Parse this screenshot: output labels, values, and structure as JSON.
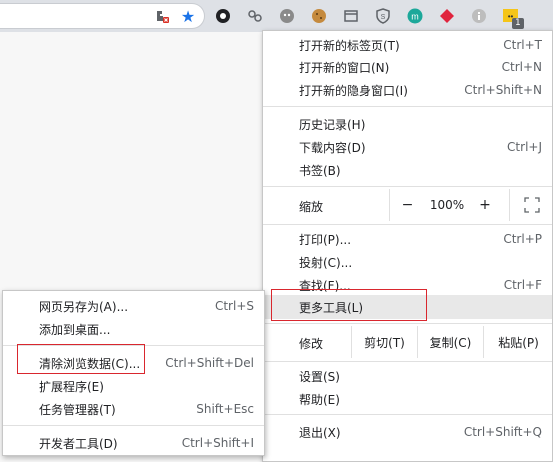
{
  "toolbar": {
    "extension_badge": "1"
  },
  "main_menu": {
    "new_tab": {
      "label": "打开新的标签页(T)",
      "shortcut": "Ctrl+T"
    },
    "new_window": {
      "label": "打开新的窗口(N)",
      "shortcut": "Ctrl+N"
    },
    "new_incognito": {
      "label": "打开新的隐身窗口(I)",
      "shortcut": "Ctrl+Shift+N"
    },
    "history": {
      "label": "历史记录(H)"
    },
    "downloads": {
      "label": "下载内容(D)",
      "shortcut": "Ctrl+J"
    },
    "bookmarks": {
      "label": "书签(B)"
    },
    "zoom": {
      "label": "缩放",
      "minus": "−",
      "value": "100%",
      "plus": "+"
    },
    "print": {
      "label": "打印(P)...",
      "shortcut": "Ctrl+P"
    },
    "cast": {
      "label": "投射(C)..."
    },
    "find": {
      "label": "查找(F)...",
      "shortcut": "Ctrl+F"
    },
    "more_tools": {
      "label": "更多工具(L)"
    },
    "edit": {
      "label": "修改",
      "cut": "剪切(T)",
      "copy": "复制(C)",
      "paste": "粘贴(P)"
    },
    "settings": {
      "label": "设置(S)"
    },
    "help": {
      "label": "帮助(E)"
    },
    "exit": {
      "label": "退出(X)",
      "shortcut": "Ctrl+Shift+Q"
    }
  },
  "submenu": {
    "save_page": {
      "label": "网页另存为(A)...",
      "shortcut": "Ctrl+S"
    },
    "add_to_desktop": {
      "label": "添加到桌面..."
    },
    "clear_data": {
      "label": "清除浏览数据(C)...",
      "shortcut": "Ctrl+Shift+Del"
    },
    "extensions": {
      "label": "扩展程序(E)"
    },
    "task_manager": {
      "label": "任务管理器(T)",
      "shortcut": "Shift+Esc"
    },
    "dev_tools": {
      "label": "开发者工具(D)",
      "shortcut": "Ctrl+Shift+I"
    }
  },
  "colors": {
    "highlight": "#d9272e",
    "star": "#1a73e8",
    "menu_bg": "#ffffff"
  }
}
